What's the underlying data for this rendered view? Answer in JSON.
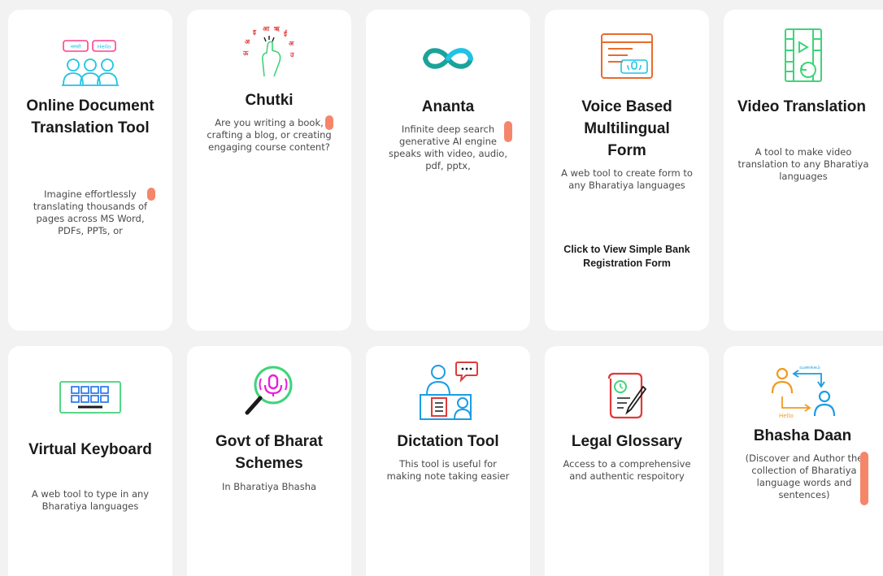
{
  "colors": {
    "accent_scroll": "#f5866a",
    "cyan": "#1fc3e6",
    "pink": "#ff3f8e",
    "green": "#3ed47a",
    "orange": "#e96b2c",
    "teal": "#1aa39a",
    "magenta": "#e91ed8",
    "red": "#e03a3a"
  },
  "cards": [
    {
      "title": "Online Document Translation Tool",
      "desc": "Imagine effortlessly translating thousands of pages across MS Word, PDFs, PPTs, or",
      "icon": "document-translation-icon",
      "icon_text_1": "नमस्ते",
      "icon_text_2": "Hello"
    },
    {
      "title": "Chutki",
      "desc": "Are you writing a book, crafting a blog, or creating engaging course content?",
      "icon": "snap-finger-icon"
    },
    {
      "title": "Ananta",
      "desc": "Infinite deep search generative AI engine speaks with video, audio, pdf, pptx,",
      "icon": "infinity-icon"
    },
    {
      "title": "Voice Based Multilingual Form",
      "desc": "A web tool to create form to any Bharatiya languages",
      "link": "Click to View Simple Bank Registration Form",
      "icon": "voice-form-icon"
    },
    {
      "title": "Video Translation",
      "desc": "A tool to make video translation to any Bharatiya languages",
      "icon": "video-translation-icon"
    },
    {
      "title": "Virtual Keyboard",
      "desc": "A web tool to type in any Bharatiya languages",
      "icon": "keyboard-icon"
    },
    {
      "title": "Govt of Bharat Schemes",
      "desc": "In Bharatiya Bhasha",
      "icon": "magnifier-microphone-icon"
    },
    {
      "title": "Dictation Tool",
      "desc": "This tool is useful for making note taking easier",
      "icon": "dictation-icon"
    },
    {
      "title": "Legal Glossary",
      "desc": "Access to a comprehensive and authentic respoitory",
      "icon": "legal-document-icon"
    },
    {
      "title": "Bhasha Daan",
      "desc": "(Discover and Author the collection of Bharatiya language words and sentences)",
      "icon": "language-exchange-icon",
      "icon_text_1": "வணக்கம்",
      "icon_text_2": "Hello"
    }
  ]
}
